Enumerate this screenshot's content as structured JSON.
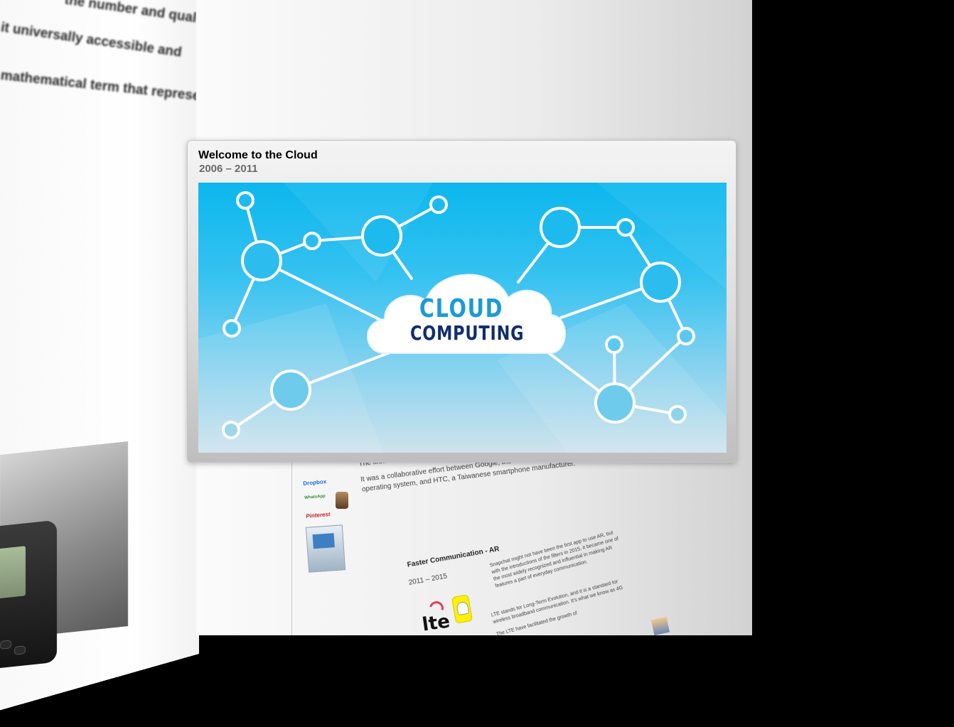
{
  "background_page": {
    "lines": [
      "the number and quality",
      "it universally accessible and",
      "mathematical term that represents"
    ]
  },
  "center_page": {
    "intro_lines": [
      "The first Android phone",
      "It was a collaborative effort between Google, the developer of",
      "operating system, and HTC, a Taiwanese smartphone manufacturer."
    ],
    "app_logos": {
      "dropbox": "Dropbox",
      "whatsapp": "WhatsApp",
      "pinterest": "Pinterest"
    },
    "ar_section": {
      "title": "Faster Communication - AR",
      "years": "2011 – 2015",
      "paragraph": [
        "Snapchat might not have been the first app to use AR, but",
        "with the introductions of the filters in 2015, it became one of",
        "the most widely recognized and influential in making AR",
        "features a part of everyday communication."
      ],
      "lte_paragraph": [
        "LTE stands for Long-Term Evolution, and it is a standard for",
        "wireless broadband communication. It's what we know as 4G",
        "The LTE have facilitated the growth of"
      ],
      "lte_logo": "lte"
    }
  },
  "card": {
    "title": "Welcome to the Cloud",
    "years": "2006 – 2011",
    "image": {
      "line1": "CLOUD",
      "line2": "COMPUTING",
      "colors": {
        "sky": "#0bb7ee",
        "cloud_word_1": "#1b9bd5",
        "cloud_word_2": "#0f2e6a"
      }
    }
  }
}
